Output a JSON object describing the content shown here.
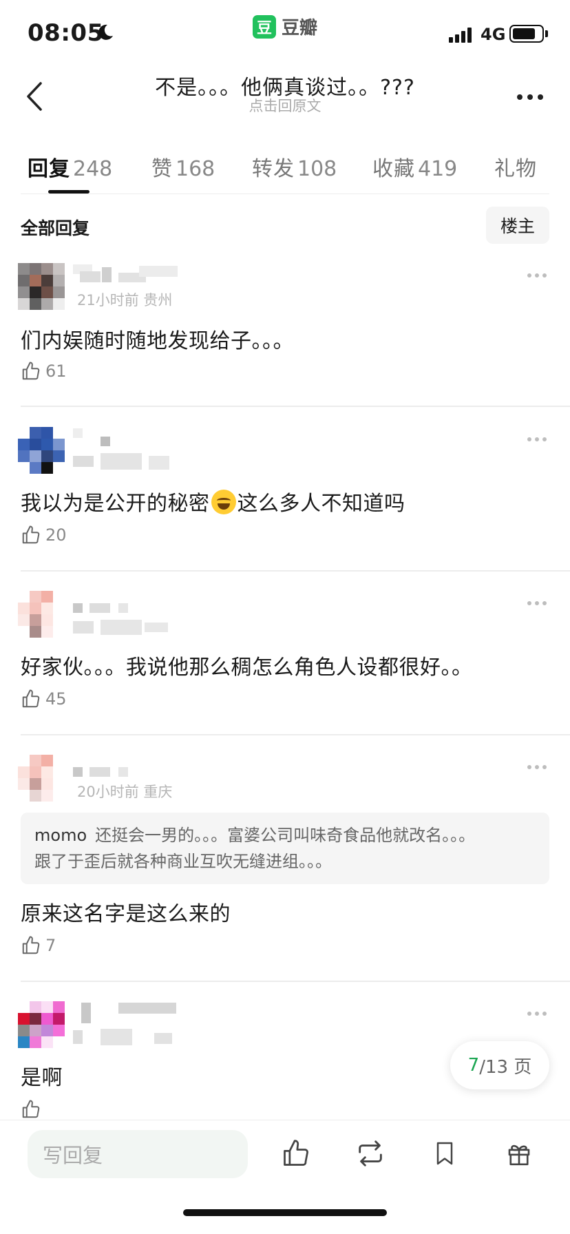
{
  "status": {
    "time": "08:05",
    "network": "4G",
    "app_brand_glyph": "豆",
    "app_brand_name": "豆瓣"
  },
  "nav": {
    "title": "不是。。。他俩真谈过。。???",
    "subtitle": "点击回原文"
  },
  "tabs": [
    {
      "label": "回复",
      "count": "248"
    },
    {
      "label": "赞",
      "count": "168"
    },
    {
      "label": "转发",
      "count": "108"
    },
    {
      "label": "收藏",
      "count": "419"
    },
    {
      "label": "礼物",
      "count": ""
    }
  ],
  "section": {
    "title": "全部回复",
    "owner_button": "楼主"
  },
  "comments": [
    {
      "meta": "21小时前 贵州",
      "text": "们内娱随时随地发现给子。。。",
      "likes": "61"
    },
    {
      "meta": "",
      "text_before": "我以为是公开的秘密",
      "emoji": "joy-emoji",
      "text_after": "这么多人不知道吗",
      "likes": "20"
    },
    {
      "meta": "",
      "text": "好家伙。。。我说他那么稠怎么角色人设都很好。。",
      "likes": "45"
    },
    {
      "meta": "20小时前 重庆",
      "quote_user": "momo",
      "quote_line1": "还挺会一男的。。。富婆公司叫味奇食品他就改名。。。",
      "quote_line2": "跟了于歪后就各种商业互吹无缝进组。。。",
      "text": "原来这名字是这么来的",
      "likes": "7"
    },
    {
      "meta": "",
      "text": "是啊",
      "likes": ""
    }
  ],
  "pagination": {
    "current": "7",
    "total_text": "/13 页"
  },
  "bottom": {
    "reply_placeholder": "写回复"
  },
  "colors": {
    "brand_green": "#21c15d",
    "page_current": "#1aa551"
  },
  "icons": [
    "moon-icon",
    "back-icon",
    "more-icon",
    "thumb-up-icon",
    "repost-icon",
    "bookmark-icon",
    "gift-icon"
  ]
}
